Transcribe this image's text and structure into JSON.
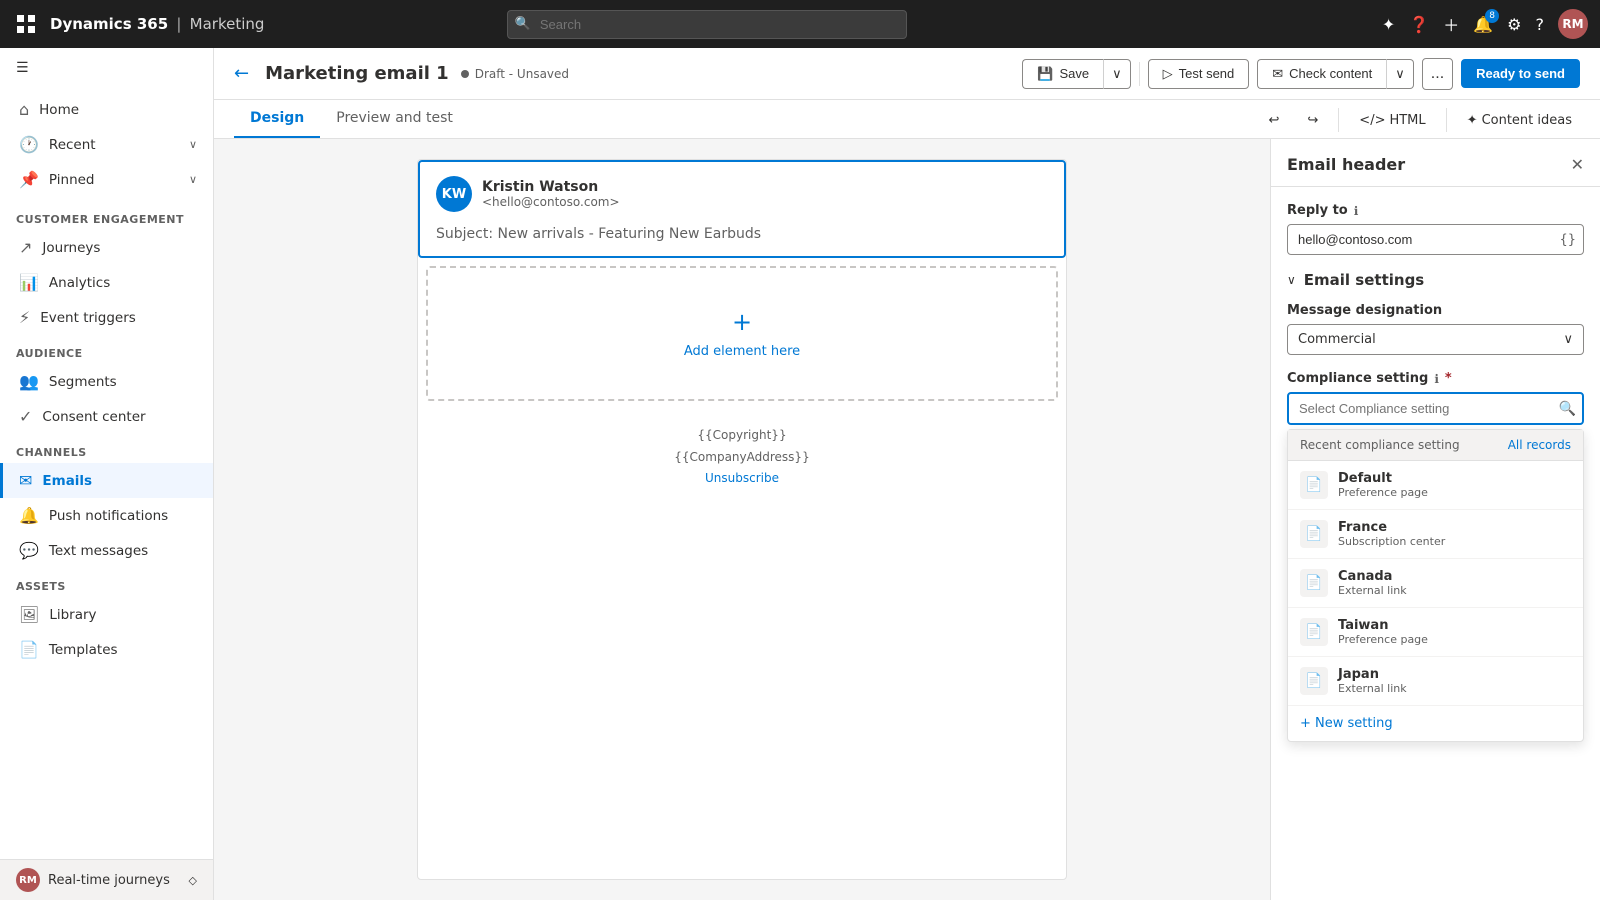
{
  "topbar": {
    "brand": "Dynamics 365",
    "module": "Marketing",
    "search_placeholder": "Search",
    "avatar_initials": "RM",
    "notification_count": "8"
  },
  "sidebar": {
    "toggle_icon": "☰",
    "nav_items": [
      {
        "id": "home",
        "label": "Home",
        "icon": "⌂"
      },
      {
        "id": "recent",
        "label": "Recent",
        "icon": "🕐",
        "has_chevron": true,
        "chevron": "∨"
      },
      {
        "id": "pinned",
        "label": "Pinned",
        "icon": "📌",
        "has_chevron": true,
        "chevron": "∨"
      }
    ],
    "sections": [
      {
        "title": "Customer engagement",
        "items": [
          {
            "id": "journeys",
            "label": "Journeys",
            "icon": "↗"
          },
          {
            "id": "analytics",
            "label": "Analytics",
            "icon": "📊"
          },
          {
            "id": "event-triggers",
            "label": "Event triggers",
            "icon": "⚡"
          }
        ]
      },
      {
        "title": "Audience",
        "items": [
          {
            "id": "segments",
            "label": "Segments",
            "icon": "👥"
          },
          {
            "id": "consent-center",
            "label": "Consent center",
            "icon": "✓"
          }
        ]
      },
      {
        "title": "Channels",
        "items": [
          {
            "id": "emails",
            "label": "Emails",
            "icon": "✉",
            "active": true
          },
          {
            "id": "push-notifications",
            "label": "Push notifications",
            "icon": "🔔"
          },
          {
            "id": "text-messages",
            "label": "Text messages",
            "icon": "💬"
          }
        ]
      },
      {
        "title": "Assets",
        "items": [
          {
            "id": "library",
            "label": "Library",
            "icon": "🖼"
          },
          {
            "id": "templates",
            "label": "Templates",
            "icon": "📄"
          }
        ]
      }
    ],
    "footer": {
      "label": "Real-time journeys",
      "initials": "RM"
    }
  },
  "page_header": {
    "back_icon": "←",
    "title": "Marketing email 1",
    "status": "Draft - Unsaved",
    "save_label": "Save",
    "test_send_label": "Test send",
    "check_content_label": "Check content",
    "more_icon": "...",
    "ready_to_send_label": "Ready to send"
  },
  "tabs": {
    "items": [
      {
        "id": "design",
        "label": "Design",
        "active": true
      },
      {
        "id": "preview-test",
        "label": "Preview and test",
        "active": false
      }
    ],
    "toolbar": {
      "undo": "↩",
      "redo": "↪",
      "html_label": "HTML",
      "content_ideas_label": "Content ideas"
    }
  },
  "email_canvas": {
    "from_initials": "KW",
    "from_name": "Kristin Watson",
    "from_email": "<hello@contoso.com>",
    "subject_prefix": "Subject:",
    "subject": "New arrivals - Featuring New Earbuds",
    "add_element_label": "Add element here",
    "add_element_icon": "+",
    "footer_copyright": "{{Copyright}}",
    "footer_company": "{{CompanyAddress}}",
    "footer_unsubscribe": "Unsubscribe"
  },
  "right_panel": {
    "title": "Email header",
    "close_icon": "✕",
    "reply_to_label": "Reply to",
    "reply_to_info": "ℹ",
    "reply_to_value": "hello@contoso.com",
    "reply_to_icon": "{}",
    "email_settings_label": "Email settings",
    "email_settings_chevron": "∨",
    "message_designation_label": "Message designation",
    "message_designation_value": "Commercial",
    "message_designation_chevron": "∨",
    "compliance_label": "Compliance setting",
    "compliance_info": "ℹ",
    "compliance_required": "*",
    "compliance_search_placeholder": "Select Compliance setting",
    "compliance_search_icon": "🔍",
    "compliance_dropdown": {
      "header_label": "Recent compliance setting",
      "all_records_label": "All records",
      "items": [
        {
          "id": "default",
          "name": "Default",
          "sub": "Preference page",
          "icon": "📄"
        },
        {
          "id": "france",
          "name": "France",
          "sub": "Subscription center",
          "icon": "📄"
        },
        {
          "id": "canada",
          "name": "Canada",
          "sub": "External link",
          "icon": "📄"
        },
        {
          "id": "taiwan",
          "name": "Taiwan",
          "sub": "Preference page",
          "icon": "📄"
        },
        {
          "id": "japan",
          "name": "Japan",
          "sub": "External link",
          "icon": "📄"
        }
      ],
      "new_setting_label": "+ New setting"
    }
  }
}
